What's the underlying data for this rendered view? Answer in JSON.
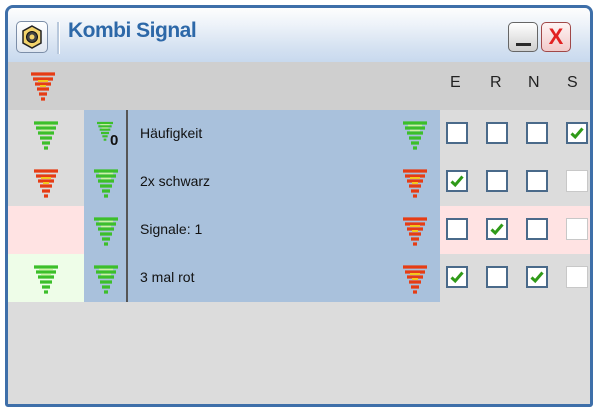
{
  "window": {
    "title": "Kombi Signal"
  },
  "header": {
    "columns": [
      "E",
      "R",
      "N",
      "S"
    ]
  },
  "rows": [
    {
      "label": "Häufigkeit",
      "count": "0"
    },
    {
      "label": "2x schwarz"
    },
    {
      "label": "Signale: 1"
    },
    {
      "label": "3 mal rot"
    }
  ],
  "checkboxes": [
    [
      "unchecked",
      "unchecked",
      "unchecked",
      "checked"
    ],
    [
      "checked",
      "unchecked",
      "unchecked",
      "disabled"
    ],
    [
      "unchecked",
      "checked",
      "unchecked",
      "disabled"
    ],
    [
      "checked",
      "unchecked",
      "checked",
      "disabled"
    ]
  ],
  "colors": {
    "title": "#2d68a8",
    "row_blue": "#a9c1dc",
    "row_pink": "#ffe3e3",
    "row_green": "#eefde8",
    "signal_green": "#3cbf2a",
    "signal_red": "#e02020"
  }
}
